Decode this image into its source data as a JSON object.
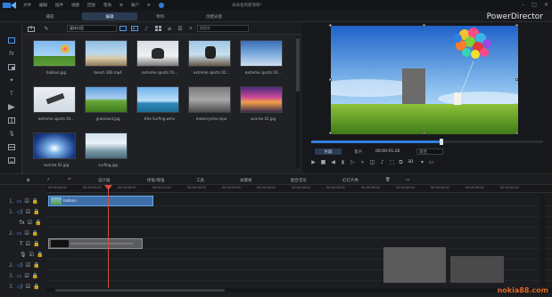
{
  "menu": {
    "items": [
      "文件",
      "编辑",
      "插件",
      "视图",
      "回放",
      "帮助"
    ],
    "extra": "账户",
    "doc_title": "未命名的新项目*"
  },
  "modes": {
    "tabs": [
      "捕获",
      "编辑",
      "制作",
      "创建光盘"
    ],
    "active": 1,
    "brand": "PowerDirector"
  },
  "library": {
    "dropdown": "媒体内容",
    "search_placeholder": "搜索库",
    "items": [
      {
        "caption": "balloon.jpg"
      },
      {
        "caption": "beach 360.mp4"
      },
      {
        "caption": "extreme sports 01..."
      },
      {
        "caption": "extreme sports 02..."
      },
      {
        "caption": "extreme sports 03..."
      },
      {
        "caption": "extreme sports 04..."
      },
      {
        "caption": "grassland.jpg"
      },
      {
        "caption": "Kite Surfing.wmv"
      },
      {
        "caption": "motorcycles.mpo"
      },
      {
        "caption": "sunrise 01.jpg"
      },
      {
        "caption": "sunrise 02.jpg"
      },
      {
        "caption": "surfing.jpg"
      }
    ]
  },
  "preview": {
    "mode_clip": "片段",
    "mode_movie": "影片",
    "timecode": "00:00:01:26",
    "fit_label": "适合",
    "progress_fraction": 0.56,
    "mode_3d": "3D"
  },
  "timeline_tools": {
    "designer": "设计器",
    "repair": "修复/增强",
    "tools": "工具",
    "keyframe": "关键帧",
    "fit_track": "配合音乐",
    "slideshow": "幻灯片秀"
  },
  "timeline": {
    "ruler": [
      "00:00:00:00",
      "00:00:04:00",
      "00:00:08:00",
      "00:00:12:00",
      "00:00:16:00",
      "00:00:20:00",
      "00:00:24:00",
      "00:00:28:00",
      "00:00:32:00",
      "00:00:36:00",
      "00:00:40:00",
      "00:00:44:00",
      "00:00:48:00",
      "00:00:52:00"
    ],
    "track_numbers": [
      "1.",
      "1.",
      "2.",
      "2.",
      "3.",
      "3."
    ],
    "clip1_label": "balloon"
  },
  "watermark": "nokia88.com",
  "colors": {
    "accent": "#2f7fe0",
    "playhead": "#d44a3a",
    "clip_video": "#3f6fa8",
    "clip_title": "#5a5c60"
  }
}
